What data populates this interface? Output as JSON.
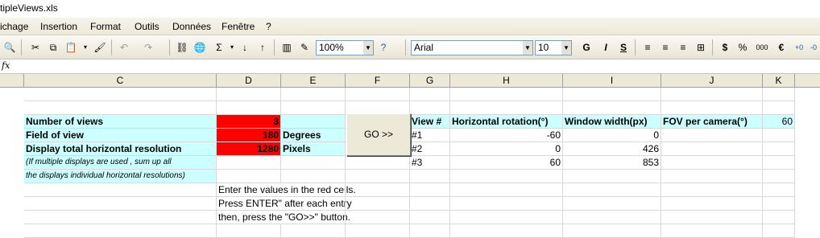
{
  "window": {
    "title": "tipleViews.xls"
  },
  "menu": {
    "items": [
      "ichage",
      "Insertion",
      "Format",
      "Outils",
      "Données",
      "Fenêtre",
      "?"
    ]
  },
  "toolbar": {
    "zoom": "100%",
    "font": "Arial",
    "size": "10",
    "bold": "G",
    "italic": "I",
    "underline": "S",
    "currency": "$",
    "percent": "%",
    "thousands": "000",
    "euro": "€"
  },
  "formula_bar": {
    "fx": "fx"
  },
  "columns": [
    "C",
    "D",
    "E",
    "F",
    "G",
    "H",
    "I",
    "J",
    "K"
  ],
  "sheet": {
    "labels": {
      "num_views": "Number of views",
      "fov": "Field of view",
      "resolution": "Display total horizontal resolution",
      "note1": "(If multiple displays are used , sum up all",
      "note2": "the displays individual horizontal resolutions)"
    },
    "inputs": {
      "num_views": "3",
      "fov": "180",
      "resolution": "1280"
    },
    "units": {
      "fov": "Degrees",
      "resolution": "Pixels"
    },
    "go_button": "GO >>",
    "instructions": [
      "Enter the values in the red cells.",
      "Press ENTER\" after each entry",
      "then, press the \"GO>>\" button."
    ],
    "table": {
      "headers": [
        "View #",
        "Horizontal rotation(°)",
        "Window width(px)",
        "FOV per camera(°)"
      ],
      "fov_per_camera": "60",
      "rows": [
        {
          "view": "#1",
          "rotation": "-60",
          "width": "0"
        },
        {
          "view": "#2",
          "rotation": "0",
          "width": "426"
        },
        {
          "view": "#3",
          "rotation": "60",
          "width": "853"
        }
      ]
    }
  }
}
